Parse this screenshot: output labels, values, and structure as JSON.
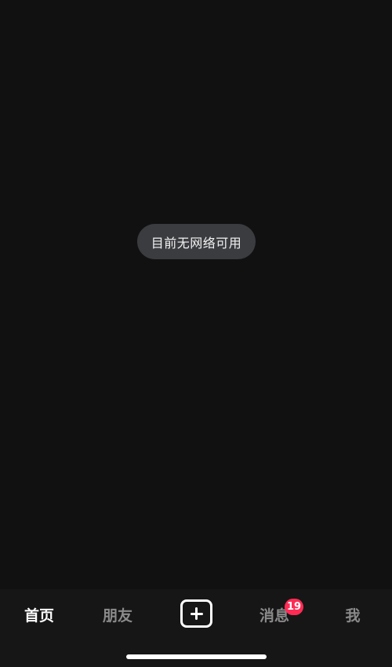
{
  "toast": {
    "message": "目前无网络可用"
  },
  "tabbar": {
    "tabs": [
      {
        "label": "首页",
        "active": true
      },
      {
        "label": "朋友",
        "active": false
      },
      {
        "label": "消息",
        "active": false
      },
      {
        "label": "我",
        "active": false
      }
    ],
    "create_icon": "plus-icon",
    "messages_badge": "19"
  },
  "colors": {
    "background": "#111111",
    "toast_background": "#3b3c40",
    "badge": "#fe2c55",
    "tab_active": "#ffffff",
    "tab_inactive": "#8a8a8a"
  }
}
